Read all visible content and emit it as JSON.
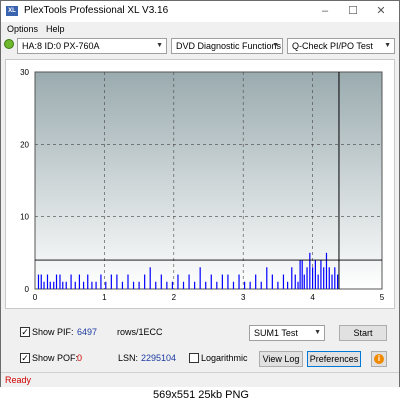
{
  "window": {
    "title": "PlexTools Professional XL V3.16",
    "icon_text": "XL"
  },
  "menu": {
    "options": "Options",
    "help": "Help"
  },
  "toolbar": {
    "drive": "HA:8 ID:0  PX-760A",
    "function": "DVD Diagnostic Functions",
    "test": "Q-Check PI/PO Test"
  },
  "chart_data": {
    "type": "bar",
    "title": "",
    "xlabel": "",
    "ylabel": "",
    "xlim": [
      0,
      5
    ],
    "ylim": [
      0,
      30
    ],
    "x_ticks": [
      "0",
      "1",
      "2",
      "3",
      "4",
      "5"
    ],
    "y_ticks": [
      "0",
      "10",
      "20",
      "30"
    ],
    "threshold": 4,
    "end_marker_x": 4.38,
    "grid": true,
    "colors": {
      "bar": "#0000ff",
      "plot_top": "#9aabaf",
      "plot_bottom": "#ffffff",
      "threshold": "#000000"
    },
    "series": [
      {
        "x": [
          0.05,
          0.09,
          0.13,
          0.18,
          0.22,
          0.27,
          0.31,
          0.36,
          0.4,
          0.45,
          0.52,
          0.58,
          0.64,
          0.7,
          0.76,
          0.82,
          0.88,
          0.95,
          1.02,
          1.1,
          1.18,
          1.26,
          1.34,
          1.42,
          1.5,
          1.58,
          1.66,
          1.74,
          1.82,
          1.9,
          1.98,
          2.06,
          2.14,
          2.22,
          2.3,
          2.38,
          2.46,
          2.54,
          2.62,
          2.7,
          2.78,
          2.86,
          2.94,
          3.02,
          3.1,
          3.18,
          3.26,
          3.34,
          3.42,
          3.5,
          3.58,
          3.64,
          3.7,
          3.75,
          3.79,
          3.82,
          3.85,
          3.88,
          3.92,
          3.96,
          4.0,
          4.04,
          4.08,
          4.12,
          4.16,
          4.2,
          4.24,
          4.28,
          4.32,
          4.36
        ],
        "values": [
          2,
          2,
          1,
          2,
          1,
          1,
          2,
          2,
          1,
          1,
          2,
          1,
          2,
          1,
          2,
          1,
          1,
          2,
          1,
          2,
          2,
          1,
          2,
          1,
          1,
          2,
          3,
          1,
          2,
          1,
          1,
          2,
          1,
          2,
          1,
          3,
          1,
          2,
          1,
          2,
          2,
          1,
          2,
          1,
          1,
          2,
          1,
          3,
          2,
          1,
          2,
          1,
          3,
          2,
          1,
          4,
          4,
          2,
          3,
          5,
          3,
          4,
          2,
          4,
          3,
          5,
          3,
          2,
          3,
          2
        ]
      }
    ]
  },
  "bottom": {
    "show_pif_label": "Show PIF:",
    "pif_value": "6497",
    "rows_label": "rows/1ECC",
    "sum_test": "SUM1 Test",
    "start_label": "Start",
    "show_pof_label": "Show POF:",
    "pof_value": "0",
    "lsn_label": "LSN:",
    "lsn_value": "2295104",
    "logarithmic_label": "Logarithmic",
    "view_log_label": "View Log",
    "preferences_label": "Preferences"
  },
  "status": {
    "text": "Ready"
  },
  "caption": "569x551  25kb  PNG"
}
